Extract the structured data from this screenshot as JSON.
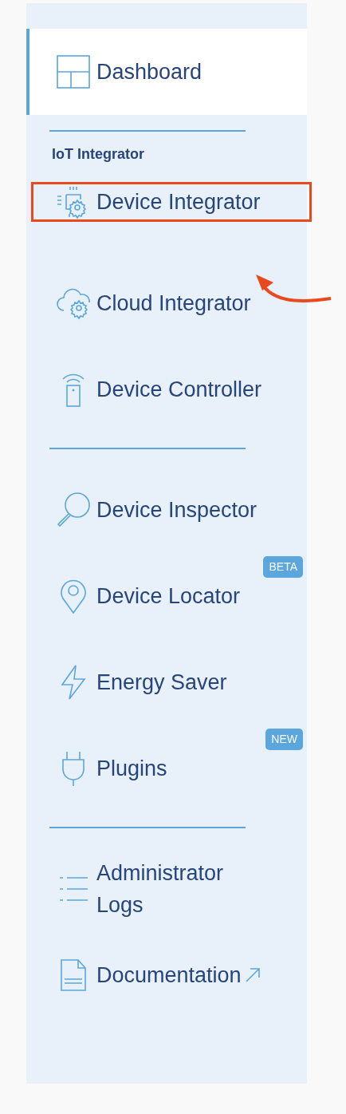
{
  "sidebar": {
    "sections": [
      {
        "items": [
          {
            "label": "Dashboard",
            "selected": true,
            "highlighted": false,
            "external": false
          }
        ]
      },
      {
        "heading": "IoT Integrator",
        "items": [
          {
            "label": "Device Integrator",
            "selected": false,
            "highlighted": true,
            "external": false
          },
          {
            "label": "Cloud Integrator",
            "selected": false,
            "highlighted": false,
            "external": false
          },
          {
            "label": "Device Controller",
            "selected": false,
            "highlighted": false,
            "external": false
          }
        ]
      },
      {
        "items": [
          {
            "label": "Device Inspector",
            "selected": false,
            "highlighted": false,
            "external": false
          },
          {
            "label": "Device Locator",
            "selected": false,
            "highlighted": false,
            "external": false,
            "badge": "BETA"
          },
          {
            "label": "Energy Saver",
            "selected": false,
            "highlighted": false,
            "external": false
          },
          {
            "label": "Plugins",
            "selected": false,
            "highlighted": false,
            "external": false,
            "badge": "NEW"
          }
        ]
      },
      {
        "items": [
          {
            "label": "Administrator Logs",
            "selected": false,
            "highlighted": false,
            "external": false
          },
          {
            "label": "Documentation",
            "selected": false,
            "highlighted": false,
            "external": true
          }
        ]
      }
    ]
  }
}
